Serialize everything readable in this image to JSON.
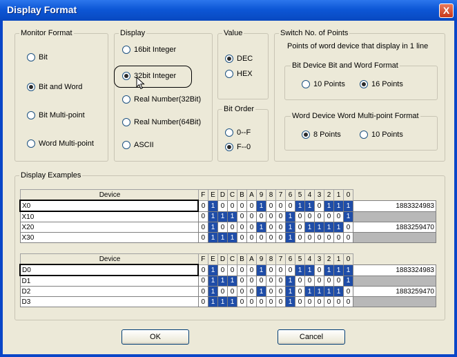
{
  "window": {
    "title": "Display Format",
    "close_label": "X"
  },
  "monitor_format": {
    "legend": "Monitor Format",
    "options": [
      {
        "label": "Bit",
        "selected": false
      },
      {
        "label": "Bit and Word",
        "selected": true
      },
      {
        "label": "Bit Multi-point",
        "selected": false
      },
      {
        "label": "Word Multi-point",
        "selected": false
      }
    ]
  },
  "display": {
    "legend": "Display",
    "options": [
      {
        "label": "16bit Integer",
        "selected": false
      },
      {
        "label": "32bit Integer",
        "selected": true
      },
      {
        "label": "Real Number(32Bit)",
        "selected": false
      },
      {
        "label": "Real Number(64Bit)",
        "selected": false
      },
      {
        "label": "ASCII",
        "selected": false
      }
    ]
  },
  "value": {
    "legend": "Value",
    "options": [
      {
        "label": "DEC",
        "selected": true
      },
      {
        "label": "HEX",
        "selected": false
      }
    ]
  },
  "bit_order": {
    "legend": "Bit Order",
    "options": [
      {
        "label": "0--F",
        "selected": false
      },
      {
        "label": "F--0",
        "selected": true
      }
    ]
  },
  "switch_points": {
    "legend": "Switch No. of Points",
    "description": "Points of word device that display in 1 line",
    "bit_word": {
      "legend": "Bit Device  Bit and Word Format",
      "options": [
        {
          "label": "10 Points",
          "selected": false
        },
        {
          "label": "16 Points",
          "selected": true
        }
      ]
    },
    "word_multi": {
      "legend": "Word Device  Word Multi-point Format",
      "options": [
        {
          "label": "8 Points",
          "selected": true
        },
        {
          "label": "10 Points",
          "selected": false
        }
      ]
    }
  },
  "examples": {
    "legend": "Display Examples",
    "bit_headers": [
      "F",
      "E",
      "D",
      "C",
      "B",
      "A",
      "9",
      "8",
      "7",
      "6",
      "5",
      "4",
      "3",
      "2",
      "1",
      "0"
    ],
    "table1": {
      "device_header": "Device",
      "rows": [
        {
          "device": "X0",
          "bits": [
            0,
            1,
            0,
            0,
            0,
            0,
            1,
            0,
            0,
            0,
            1,
            1,
            0,
            1,
            1,
            1
          ],
          "value": "1883324983"
        },
        {
          "device": "X10",
          "bits": [
            0,
            1,
            1,
            1,
            0,
            0,
            0,
            0,
            0,
            1,
            0,
            0,
            0,
            0,
            0,
            1
          ],
          "value": ""
        },
        {
          "device": "X20",
          "bits": [
            0,
            1,
            0,
            0,
            0,
            0,
            1,
            0,
            0,
            1,
            0,
            1,
            1,
            1,
            1,
            0
          ],
          "value": "1883259470"
        },
        {
          "device": "X30",
          "bits": [
            0,
            1,
            1,
            1,
            0,
            0,
            0,
            0,
            0,
            1,
            0,
            0,
            0,
            0,
            0,
            0
          ],
          "value": ""
        }
      ]
    },
    "table2": {
      "device_header": "Device",
      "rows": [
        {
          "device": "D0",
          "bits": [
            0,
            1,
            0,
            0,
            0,
            0,
            1,
            0,
            0,
            0,
            1,
            1,
            0,
            1,
            1,
            1
          ],
          "value": "1883324983"
        },
        {
          "device": "D1",
          "bits": [
            0,
            1,
            1,
            1,
            0,
            0,
            0,
            0,
            0,
            1,
            0,
            0,
            0,
            0,
            0,
            1
          ],
          "value": ""
        },
        {
          "device": "D2",
          "bits": [
            0,
            1,
            0,
            0,
            0,
            0,
            1,
            0,
            0,
            1,
            0,
            1,
            1,
            1,
            1,
            0
          ],
          "value": "1883259470"
        },
        {
          "device": "D3",
          "bits": [
            0,
            1,
            1,
            1,
            0,
            0,
            0,
            0,
            0,
            1,
            0,
            0,
            0,
            0,
            0,
            0
          ],
          "value": ""
        }
      ]
    }
  },
  "buttons": {
    "ok": "OK",
    "cancel": "Cancel"
  },
  "colors": {
    "title_bar": "#0d57d6",
    "dialog_bg": "#ece9d8",
    "bit_on": "#1f4da8",
    "value_empty": "#b8b8b8"
  }
}
